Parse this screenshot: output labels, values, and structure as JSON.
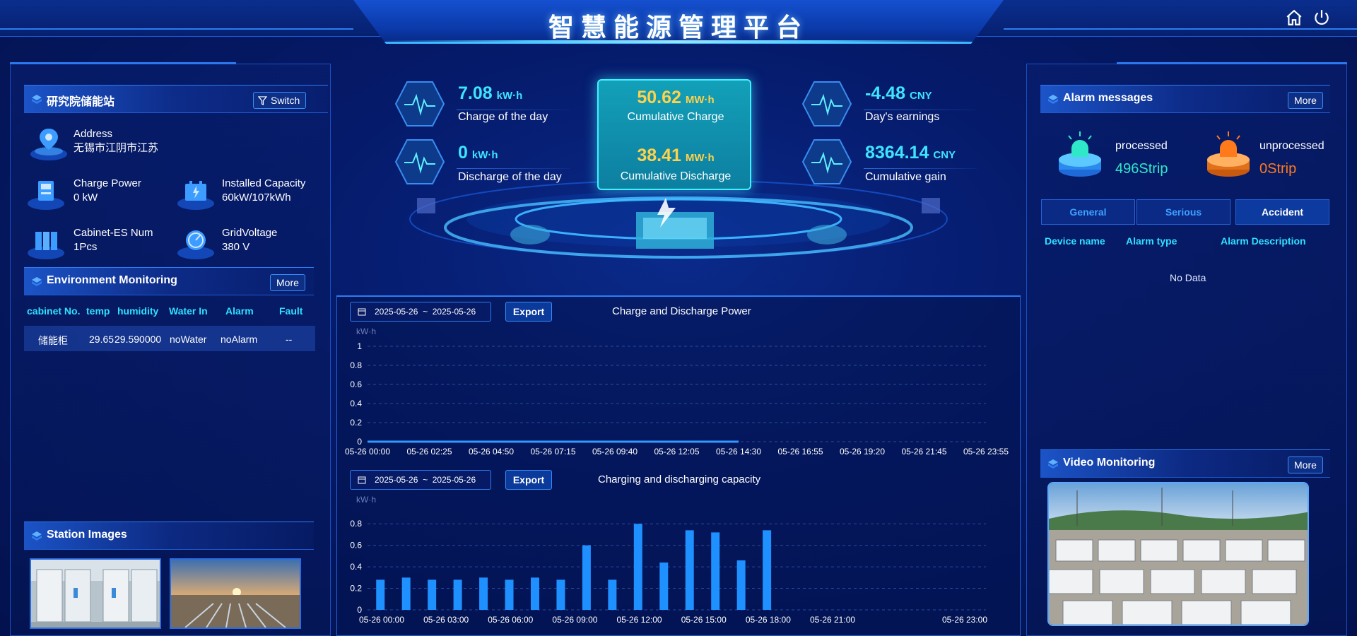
{
  "header": {
    "title": "智慧能源管理平台",
    "home_icon": "home-icon",
    "power_icon": "power-icon"
  },
  "station": {
    "name": "研究院储能站",
    "switch_label": "Switch",
    "address_label": "Address",
    "address_value": "无锡市江阴市江苏",
    "charge_power_label": "Charge Power",
    "charge_power_value": "0 kW",
    "installed_capacity_label": "Installed Capacity",
    "installed_capacity_value": "60kW/107kWh",
    "cabinet_num_label": "Cabinet-ES Num",
    "cabinet_num_value": "1Pcs",
    "grid_voltage_label": "GridVoltage",
    "grid_voltage_value": "380 V"
  },
  "environment": {
    "title": "Environment Monitoring",
    "more_label": "More",
    "columns": [
      "cabinet No.",
      "temp",
      "humidity",
      "Water In",
      "Alarm",
      "Fault"
    ],
    "rows": [
      [
        "储能柜",
        "29.65",
        "29.590000",
        "noWater",
        "noAlarm",
        "--"
      ]
    ]
  },
  "station_images": {
    "title": "Station Images"
  },
  "stats": {
    "charge_day_value": "7.08",
    "charge_day_unit": "kW·h",
    "charge_day_label": "Charge of the day",
    "discharge_day_value": "0",
    "discharge_day_unit": "kW·h",
    "discharge_day_label": "Discharge of the day",
    "cum_charge_value": "50.62",
    "cum_charge_unit": "MW·h",
    "cum_charge_label": "Cumulative Charge",
    "cum_discharge_value": "38.41",
    "cum_discharge_unit": "MW·h",
    "cum_discharge_label": "Cumulative Discharge",
    "earnings_value": "-4.48",
    "earnings_unit": "CNY",
    "earnings_label": "Day's earnings",
    "gain_value": "8364.14",
    "gain_unit": "CNY",
    "gain_label": "Cumulative gain"
  },
  "power_chart_controls": {
    "date_start": "2025-05-26",
    "date_sep": "~",
    "date_end": "2025-05-26",
    "export_label": "Export"
  },
  "capacity_chart_controls": {
    "date_start": "2025-05-26",
    "date_sep": "~",
    "date_end": "2025-05-26",
    "export_label": "Export"
  },
  "chart_data": [
    {
      "type": "line",
      "title": "Charge and Discharge Power",
      "ylabel": "kW·h",
      "ylim": [
        0,
        1
      ],
      "yticks": [
        "0",
        "0.2",
        "0.4",
        "0.6",
        "0.8",
        "1"
      ],
      "x": [
        "05-26 00:00",
        "05-26 02:25",
        "05-26 04:50",
        "05-26 07:15",
        "05-26 09:40",
        "05-26 12:05",
        "05-26 14:30",
        "05-26 16:55",
        "05-26 19:20",
        "05-26 21:45",
        "05-26 23:55"
      ],
      "series": [
        {
          "values": [
            0,
            0,
            0,
            0,
            0,
            0,
            0,
            null,
            null,
            null,
            null
          ]
        }
      ],
      "grid": true,
      "color": "#2f9bff"
    },
    {
      "type": "bar",
      "title": "Charging and discharging capacity",
      "ylabel": "kW·h",
      "ylim": [
        0,
        0.9
      ],
      "yticks": [
        "0",
        "0.2",
        "0.4",
        "0.6",
        "0.8"
      ],
      "xticks": [
        "05-26 00:00",
        "05-26 03:00",
        "05-26 06:00",
        "05-26 09:00",
        "05-26 12:00",
        "05-26 15:00",
        "05-26 18:00",
        "05-26 21:00",
        "05-26 23:00"
      ],
      "values": [
        0.28,
        0.3,
        0.28,
        0.28,
        0.3,
        0.28,
        0.3,
        0.28,
        0.6,
        0.28,
        0.8,
        0.44,
        0.74,
        0.72,
        0.46,
        0.74,
        0,
        0,
        0,
        0,
        0,
        0,
        0,
        0
      ],
      "grid": true,
      "color": "#1e90ff"
    }
  ],
  "alarm": {
    "title": "Alarm messages",
    "more_label": "More",
    "processed_label": "processed",
    "processed_value": "496Strip",
    "unprocessed_label": "unprocessed",
    "unprocessed_value": "0Strip",
    "tabs": [
      "General",
      "Serious",
      "Accident"
    ],
    "active_tab": "Accident",
    "columns": [
      "Device name",
      "Alarm type",
      "Alarm Description"
    ],
    "empty_text": "No Data"
  },
  "video": {
    "title": "Video Monitoring",
    "more_label": "More"
  },
  "colors": {
    "accent_cyan": "#3ee4ff",
    "accent_gold": "#ffd24a",
    "processed_green": "#2ee8c8",
    "unprocessed_orange": "#ff7a1a",
    "panel_blue": "#2c78f0"
  }
}
